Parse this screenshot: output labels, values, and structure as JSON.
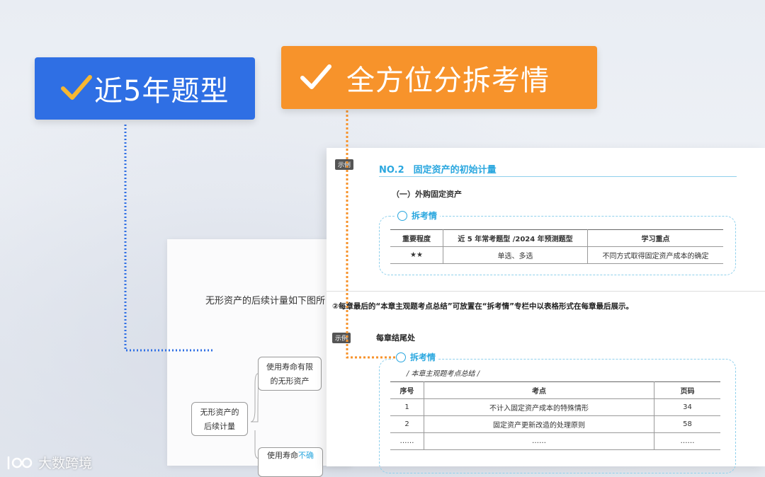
{
  "tags": {
    "blue": {
      "text": "近5年题型",
      "bg": "#2f6fe4",
      "check_color": "#f7b731"
    },
    "orange": {
      "text": "全方位分拆考情",
      "bg": "#f7932b",
      "check_color": "#ffffff"
    }
  },
  "back_doc": {
    "intro": "无形资产的后续计量如下图所",
    "mind_root": [
      "无形资产的",
      "后续计量"
    ],
    "branch1": [
      "使用寿命有限",
      "的无形资产"
    ],
    "branch2_prefix": "使用寿命",
    "branch2_highlight": "不确"
  },
  "front_doc": {
    "badge1": "示例",
    "section_title": "NO.2　固定资产的初始计量",
    "subsection": "（一）外购固定资产",
    "panel_label": "拆考情",
    "table1": {
      "headers": [
        "重要程度",
        "近 5 年常考题型 /2024 年预测题型",
        "学习重点"
      ],
      "row": [
        "★★",
        "单选、多选",
        "不同方式取得固定资产成本的确定"
      ]
    },
    "note": "②每章最后的“本章主观题考点总结”可放置在“拆考情”专栏中以表格形式在每章最后展示。",
    "badge2": "示例",
    "chapter_end": "每章结尾处",
    "panel2_label": "拆考情",
    "table2_caption": "/ 本章主观题考点总结 /",
    "table2": {
      "headers": [
        "序号",
        "考点",
        "页码"
      ],
      "rows": [
        [
          "1",
          "不计入固定资产成本的特殊情形",
          "34"
        ],
        [
          "2",
          "固定资产更新改造的处理原则",
          "58"
        ],
        [
          "……",
          "……",
          "……"
        ]
      ]
    }
  },
  "watermark": "大数跨境"
}
